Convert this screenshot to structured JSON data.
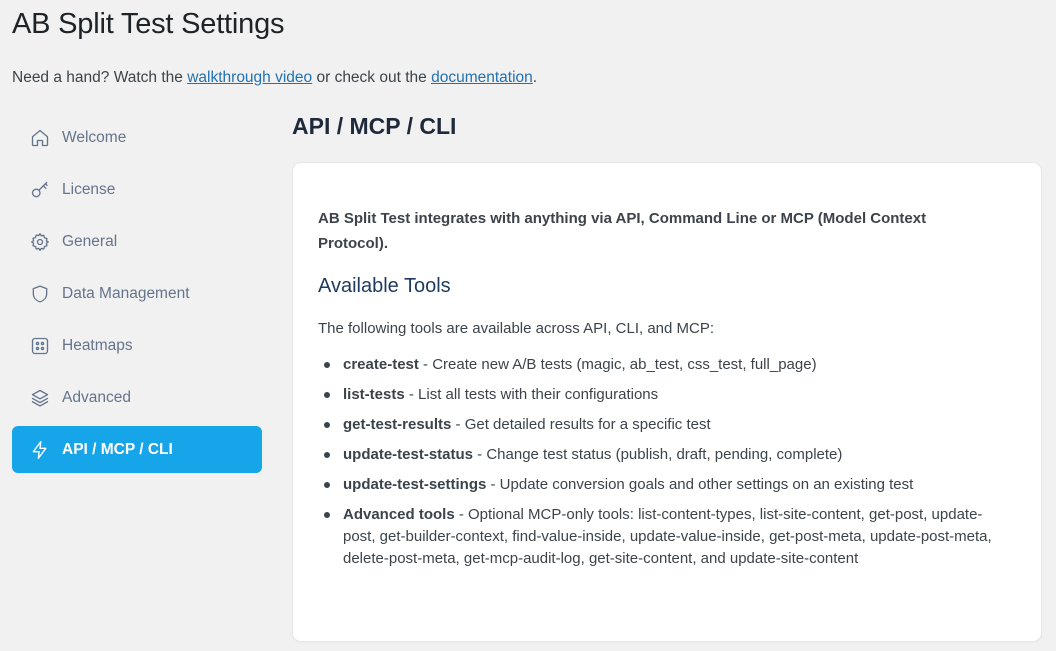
{
  "page": {
    "title": "AB Split Test Settings",
    "help_prefix": "Need a hand? Watch the ",
    "help_link1": "walkthrough video",
    "help_middle": " or check out the ",
    "help_link2": "documentation",
    "help_suffix": "."
  },
  "sidebar": {
    "items": [
      {
        "label": "Welcome",
        "icon": "home-icon"
      },
      {
        "label": "License",
        "icon": "key-icon"
      },
      {
        "label": "General",
        "icon": "gear-icon"
      },
      {
        "label": "Data Management",
        "icon": "shield-icon"
      },
      {
        "label": "Heatmaps",
        "icon": "grid-icon"
      },
      {
        "label": "Advanced",
        "icon": "layers-icon"
      },
      {
        "label": "API / MCP / CLI",
        "icon": "lightning-icon",
        "active": true
      }
    ]
  },
  "main": {
    "section_title": "API / MCP / CLI",
    "intro": "AB Split Test integrates with anything via API, Command Line or MCP (Model Context Protocol).",
    "tools_heading": "Available Tools",
    "tools_desc": "The following tools are available across API, CLI, and MCP:",
    "tools": [
      {
        "name": "create-test",
        "desc": " - Create new A/B tests (magic, ab_test, css_test, full_page)"
      },
      {
        "name": "list-tests",
        "desc": " - List all tests with their configurations"
      },
      {
        "name": "get-test-results",
        "desc": " - Get detailed results for a specific test"
      },
      {
        "name": "update-test-status",
        "desc": " - Change test status (publish, draft, pending, complete)"
      },
      {
        "name": "update-test-settings",
        "desc": " - Update conversion goals and other settings on an existing test"
      },
      {
        "name": "Advanced tools",
        "desc": " - Optional MCP-only tools: list-content-types, list-site-content, get-post, update-post, get-builder-context, find-value-inside, update-value-inside, get-post-meta, update-post-meta, delete-post-meta, get-mcp-audit-log, get-site-content, and update-site-content"
      }
    ]
  },
  "colors": {
    "accent": "#16a5e8",
    "link": "#2271b1",
    "background": "#f1f1f1"
  }
}
